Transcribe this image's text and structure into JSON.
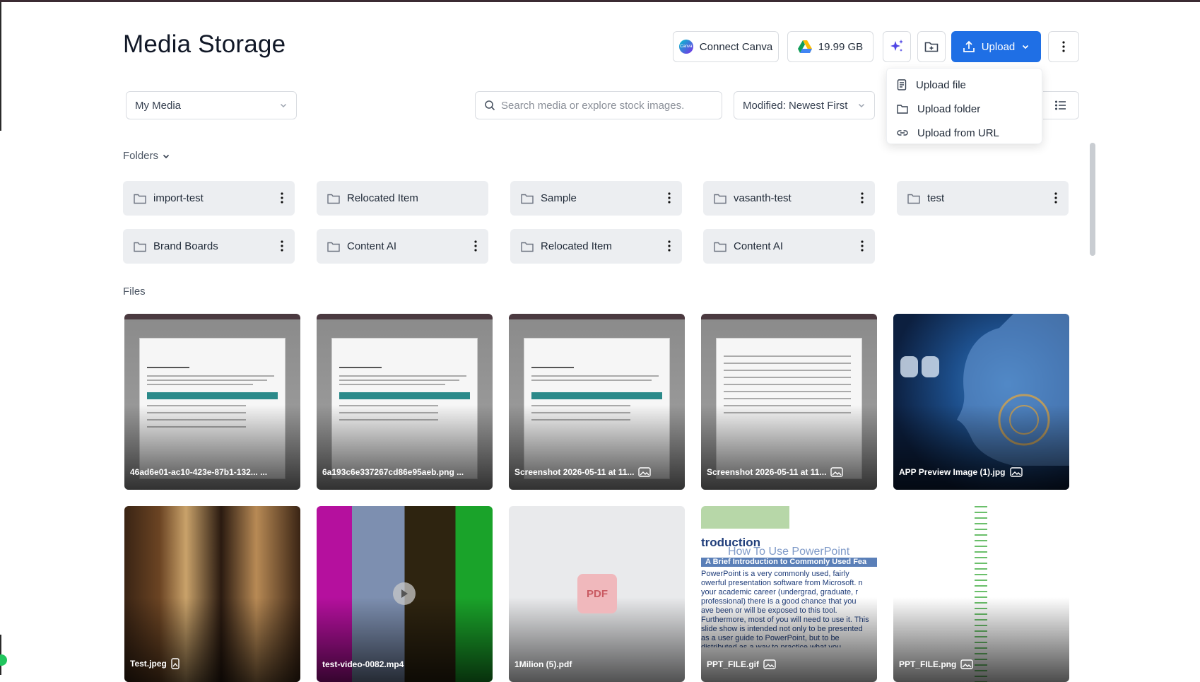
{
  "header": {
    "title": "Media Storage",
    "connect_canva": "Connect Canva",
    "canva_logo_text": "Canva",
    "storage": "19.99 GB",
    "upload": "Upload"
  },
  "upload_menu": {
    "items": [
      {
        "label": "Upload file",
        "icon": "file-icon"
      },
      {
        "label": "Upload folder",
        "icon": "folder-icon"
      },
      {
        "label": "Upload from URL",
        "icon": "link-icon"
      }
    ]
  },
  "toolbar": {
    "source_select": "My Media",
    "search_placeholder": "Search media or explore stock images.",
    "sort_select": "Modified: Newest First"
  },
  "folders": {
    "label": "Folders",
    "items": [
      {
        "name": "import-test"
      },
      {
        "name": "Relocated Item"
      },
      {
        "name": "Sample"
      },
      {
        "name": "vasanth-test"
      },
      {
        "name": "test"
      },
      {
        "name": "Brand Boards"
      },
      {
        "name": "Content AI"
      },
      {
        "name": "Relocated Item"
      },
      {
        "name": "Content AI"
      }
    ]
  },
  "files": {
    "label": "Files",
    "items": [
      {
        "name": "46ad6e01-ac10-423e-87b1-132... ..."
      },
      {
        "name": "6a193c6e337267cd86e95aeb.png ..."
      },
      {
        "name": "Screenshot 2026-05-11 at 11..."
      },
      {
        "name": "Screenshot 2026-05-11 at 11..."
      },
      {
        "name": "APP Preview Image (1).jpg"
      },
      {
        "name": "Test.jpeg"
      },
      {
        "name": "test-video-0082.mp4"
      },
      {
        "name": "1Milion (5).pdf",
        "badge": "PDF"
      },
      {
        "name": "PPT_FILE.gif"
      },
      {
        "name": "PPT_FILE.png"
      }
    ]
  },
  "ppt_preview": {
    "heading": "troduction",
    "subheading": "How To Use PowerPoint",
    "band": "A Brief Introduction to Commonly Used Fea",
    "body": "PowerPoint is a very commonly used, fairly owerful presentation software from Microsoft. n your academic career (undergrad, graduate, r professional) there is a good chance that you ave been or will be exposed to this tool. Furthermore, most of you will need to use it. This slide show is intended not only to be presented as a user guide to PowerPoint, but to be distributed as a way to practice what you"
  },
  "colors": {
    "accent": "#1f6fe5",
    "folder_bg": "#eceef1",
    "border": "#d9dce1"
  }
}
